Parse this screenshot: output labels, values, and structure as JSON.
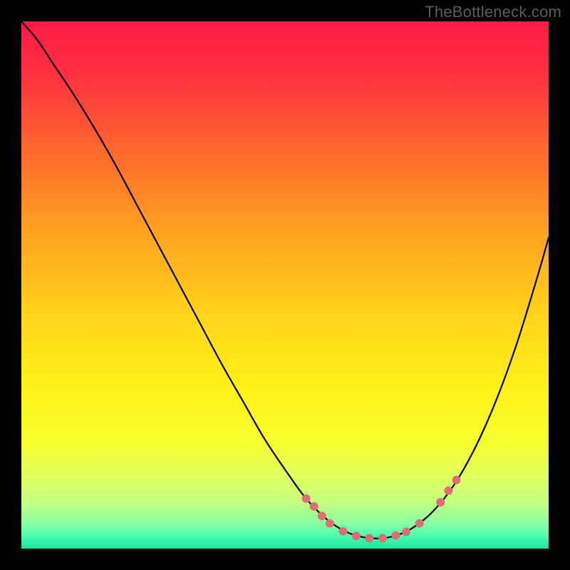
{
  "attribution": "TheBottleneck.com",
  "gradient": {
    "stops": [
      {
        "offset": 0.0,
        "color": "#ff1a47"
      },
      {
        "offset": 0.1,
        "color": "#ff2f3f"
      },
      {
        "offset": 0.25,
        "color": "#ff6a2b"
      },
      {
        "offset": 0.4,
        "color": "#ffa21f"
      },
      {
        "offset": 0.55,
        "color": "#ffd21a"
      },
      {
        "offset": 0.7,
        "color": "#fff218"
      },
      {
        "offset": 0.8,
        "color": "#f6ff2e"
      },
      {
        "offset": 0.86,
        "color": "#e2ff5a"
      },
      {
        "offset": 0.91,
        "color": "#c5ff80"
      },
      {
        "offset": 0.95,
        "color": "#8dffa0"
      },
      {
        "offset": 0.975,
        "color": "#4dffb0"
      },
      {
        "offset": 1.0,
        "color": "#16e59b"
      }
    ]
  },
  "chart_data": {
    "type": "line",
    "title": "",
    "xlabel": "",
    "ylabel": "",
    "xlim": [
      0,
      100
    ],
    "ylim": [
      0,
      100
    ],
    "grid": false,
    "legend": false,
    "series": [
      {
        "name": "bottleneck-curve",
        "x": [
          0,
          3,
          6,
          10,
          14,
          18,
          22,
          26,
          30,
          34,
          38,
          42,
          46,
          50,
          54,
          58,
          62,
          66,
          70,
          74,
          78,
          82,
          86,
          90,
          94,
          98,
          100
        ],
        "y": [
          100,
          96.5,
          92,
          86,
          79.5,
          72.5,
          65,
          57.5,
          50,
          42.5,
          35,
          28,
          21,
          15,
          9.5,
          5.5,
          3,
          2,
          2.2,
          3.8,
          7,
          12,
          19,
          28,
          39,
          52,
          59
        ]
      }
    ],
    "markers": [
      {
        "x": 54,
        "y": 9.5
      },
      {
        "x": 55.5,
        "y": 8.0
      },
      {
        "x": 57,
        "y": 6.2
      },
      {
        "x": 58.5,
        "y": 4.8
      },
      {
        "x": 61,
        "y": 3.3
      },
      {
        "x": 63.5,
        "y": 2.4
      },
      {
        "x": 66,
        "y": 2.0
      },
      {
        "x": 68.5,
        "y": 2.0
      },
      {
        "x": 71,
        "y": 2.5
      },
      {
        "x": 73,
        "y": 3.2
      },
      {
        "x": 75.5,
        "y": 4.8
      },
      {
        "x": 79.5,
        "y": 8.8
      },
      {
        "x": 81,
        "y": 11.0
      },
      {
        "x": 82.5,
        "y": 13.0
      }
    ],
    "marker_style": {
      "color": "#e06d74",
      "radius_px": 6
    }
  }
}
